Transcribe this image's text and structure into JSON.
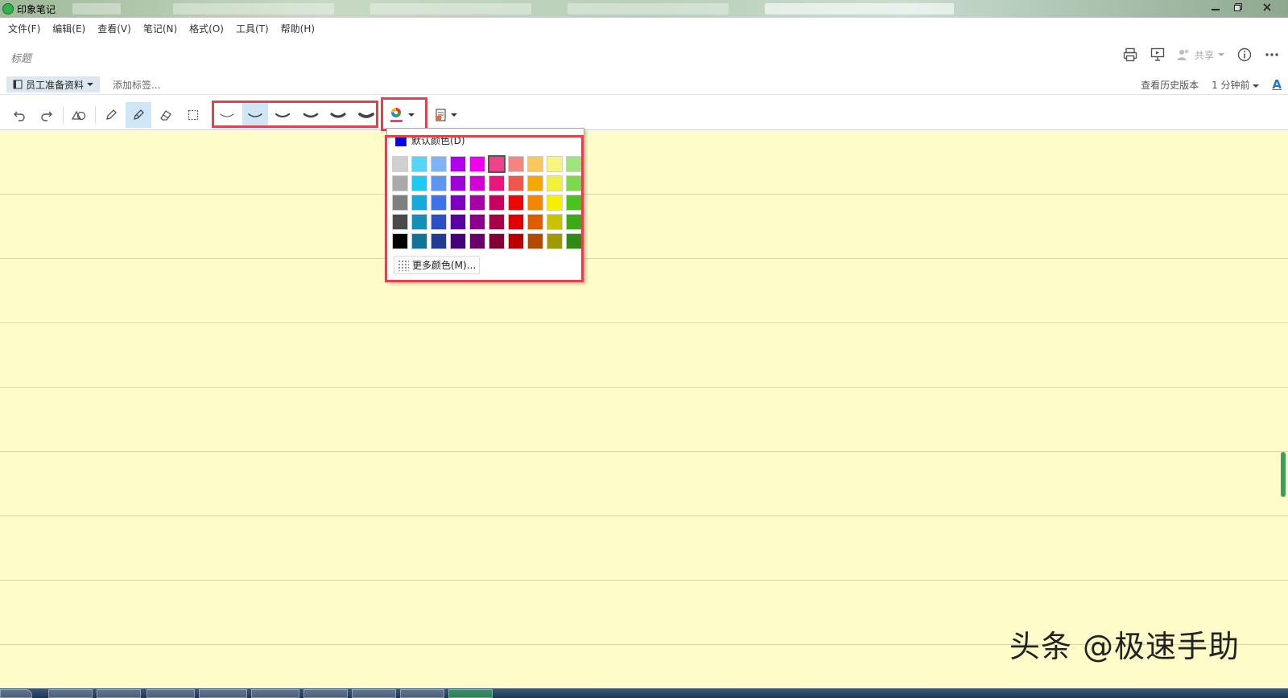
{
  "window": {
    "title": "印象笔记",
    "controls": [
      "minimize",
      "restore",
      "close"
    ]
  },
  "menu": [
    "文件(F)",
    "编辑(E)",
    "查看(V)",
    "笔记(N)",
    "格式(O)",
    "工具(T)",
    "帮助(H)"
  ],
  "note": {
    "title_placeholder": "标题",
    "notebook": "员工准备资料",
    "add_tag": "添加标签...",
    "history": "查看历史版本",
    "time": "1 分钟前",
    "font_button": "A",
    "share": "共享"
  },
  "toolbar": {
    "pen_widths": 6,
    "active_tool": "highlighter-pen",
    "selected_width_index": 1,
    "color_button_color": "#e8437b"
  },
  "color_menu": {
    "default_label": "默认颜色(D)",
    "default_color": "#0000ff",
    "more_label": "更多颜色(M)...",
    "selected_color": "#f0428c",
    "rows": [
      [
        "#d0d0d0",
        "#55d5f7",
        "#7fb3f5",
        "#b000ee",
        "#ee00ee",
        "#f0428c",
        "#f2857f",
        "#fbc75c",
        "#f7f77e",
        "#9ee37e"
      ],
      [
        "#a9a9a9",
        "#1ccaf4",
        "#5b96f3",
        "#9d00d8",
        "#d300d3",
        "#e8157a",
        "#f2554a",
        "#f7a800",
        "#f0f03d",
        "#7dd84d"
      ],
      [
        "#7f7f7f",
        "#16aadb",
        "#3f72ea",
        "#7b00c0",
        "#a800a8",
        "#c80060",
        "#ec0808",
        "#f48700",
        "#f5f000",
        "#4bc21d"
      ],
      [
        "#4a4a4a",
        "#148fb5",
        "#2e4fc3",
        "#5a00a0",
        "#8a008a",
        "#a80048",
        "#e00000",
        "#e05c00",
        "#c8c200",
        "#3aaa16"
      ],
      [
        "#000000",
        "#127297",
        "#213a94",
        "#43007a",
        "#6a006a",
        "#820034",
        "#b80000",
        "#b34a00",
        "#9e9a00",
        "#2f8a13"
      ]
    ]
  },
  "canvas_color": "#fefcc8",
  "watermark": "头条 @极速手助"
}
